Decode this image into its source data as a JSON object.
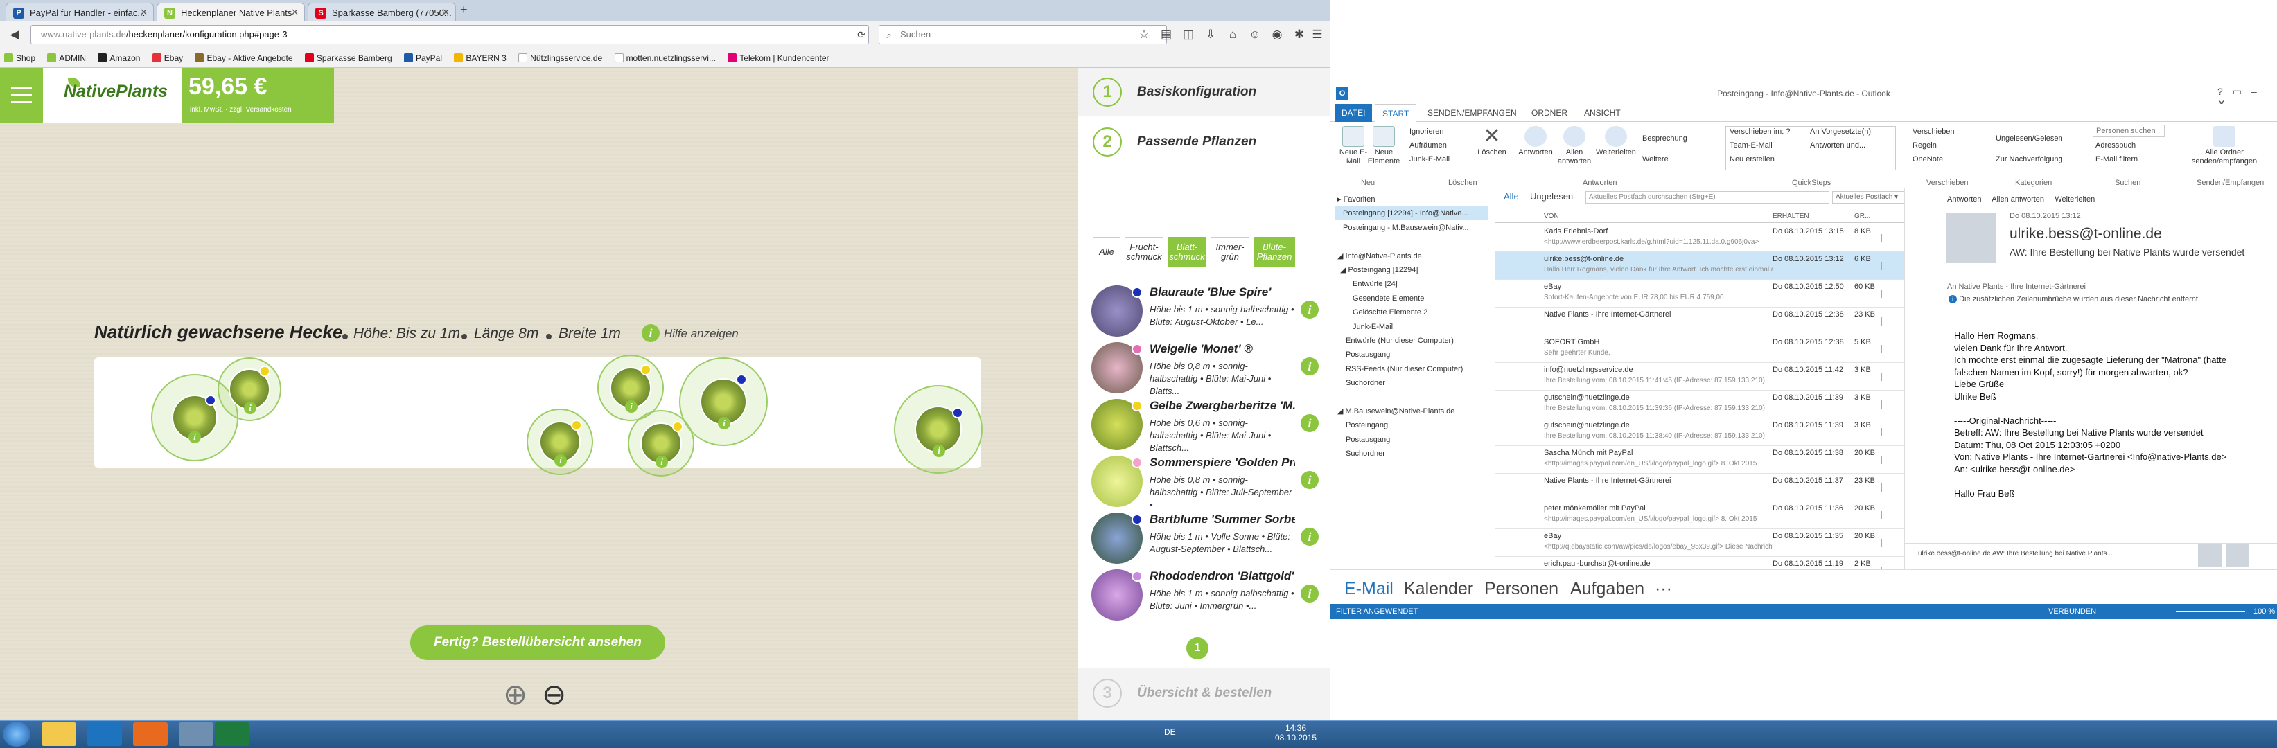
{
  "browser": {
    "tabs": [
      {
        "label": "PayPal für Händler - einfac...",
        "active": false
      },
      {
        "label": "Heckenplaner Native Plants",
        "active": true
      },
      {
        "label": "Sparkasse Bamberg (77050...",
        "active": false
      }
    ],
    "new_tab": "+",
    "url_prefix": "www.native-plants.de",
    "url_path": "/heckenplaner/konfiguration.php#page-3",
    "search_placeholder": "Suchen",
    "bookmarks": [
      "Shop",
      "ADMIN",
      "Amazon",
      "Ebay",
      "Ebay - Aktive Angebote",
      "Sparkasse Bamberg",
      "PayPal",
      "BAYERN 3",
      "Nützlingsservice.de",
      "motten.nuetzlingsservi...",
      "Telekom | Kundencenter"
    ]
  },
  "site": {
    "logo_text": "NativePlants",
    "price": "59,65 €",
    "price_note": "inkl. MwSt. · zzgl. Versandkosten",
    "hedge_title": "Natürlich gewachsene Hecke",
    "hedge_height": "Höhe: Bis zu 1m",
    "hedge_length": "Länge 8m",
    "hedge_width": "Breite 1m",
    "help_label": "Hilfe anzeigen",
    "done_button": "Fertig? Bestellübersicht ansehen",
    "zoom_in": "⊕",
    "zoom_out": "⊖",
    "info_glyph": "i"
  },
  "panel": {
    "step1": {
      "num": "1",
      "label": "Basiskonfiguration"
    },
    "step2": {
      "num": "2",
      "label": "Passende Pflanzen"
    },
    "step3": {
      "num": "3",
      "label": "Übersicht & bestellen"
    },
    "filters": [
      {
        "label": "Alle",
        "active": false
      },
      {
        "label": "Frucht-\nschmuck",
        "active": false
      },
      {
        "label": "Blatt-\nschmuck",
        "active": true
      },
      {
        "label": "Immer-\ngrün",
        "active": false
      },
      {
        "label": "Blüte-\nPflanzen",
        "active": true
      }
    ],
    "plants": [
      {
        "name": "Blauraute 'Blue Spire'",
        "desc": "Höhe bis 1 m • sonnig-halbschattig • Blüte: August-Oktober • Le...",
        "dot": "#1a2fb8"
      },
      {
        "name": "Weigelie 'Monet' ®",
        "desc": "Höhe bis 0,8 m • sonnig-halbschattig • Blüte: Mai-Juni • Blatts...",
        "dot": "#e36fb7"
      },
      {
        "name": "Gelbe Zwergberberitze 'M...",
        "desc": "Höhe bis 0,6 m • sonnig-halbschattig • Blüte: Mai-Juni • Blattsch...",
        "dot": "#f2d31b"
      },
      {
        "name": "Sommerspiere 'Golden Pri...",
        "desc": "Höhe bis 0,8 m • sonnig-halbschattig • Blüte: Juli-September •",
        "dot": "#f4a3cf"
      },
      {
        "name": "Bartblume 'Summer Sorbe...",
        "desc": "Höhe bis 1 m • Volle Sonne • Blüte: August-September • Blattsch...",
        "dot": "#1a2fb8"
      },
      {
        "name": "Rhododendron 'Blattgold'",
        "desc": "Höhe bis 1 m • sonnig-halbschattig • Blüte: Juni • Immergrün •...",
        "dot": "#c78be0"
      }
    ],
    "page": "1"
  },
  "outlook": {
    "title": "Posteingang - Info@Native-Plants.de - Outlook",
    "menu": [
      "DATEI",
      "START",
      "SENDEN/EMPFANGEN",
      "ORDNER",
      "ANSICHT"
    ],
    "ribbon": {
      "new_email": "Neue E-Mail",
      "new_items": "Neue Elemente",
      "group_new": "Neu",
      "ignore": "Ignorieren",
      "cleanup": "Aufräumen",
      "junk": "Junk-E-Mail",
      "delete": "Löschen",
      "group_delete": "Löschen",
      "reply": "Antworten",
      "reply_all": "Allen antworten",
      "forward": "Weiterleiten",
      "meeting": "Besprechung",
      "more": "Weitere",
      "group_reply": "Antworten",
      "qs1": "Verschieben im: ?",
      "qs2": "Team-E-Mail",
      "qs3": "Neu erstellen",
      "qs4": "An Vorgesetzte(n)",
      "qs5": "Antworten und...",
      "group_quick": "QuickSteps",
      "move": "Verschieben",
      "rules": "Regeln",
      "onenote": "OneNote",
      "group_move": "Verschieben",
      "unread": "Ungelesen/Gelesen",
      "followup": "Zur Nachverfolgung",
      "group_tags": "Kategorien",
      "search_people": "Personen suchen",
      "addressbook": "Adressbuch",
      "filter": "E-Mail filtern",
      "group_find": "Suchen",
      "sendall": "Alle Ordner senden/empfangen",
      "group_send": "Senden/Empfangen"
    },
    "folders": [
      {
        "label": "▸ Favoriten",
        "indent": 0,
        "sel": false
      },
      {
        "label": "Posteingang [12294]  - Info@Native...",
        "indent": 8,
        "sel": true
      },
      {
        "label": "Posteingang  - M.Bausewein@Nativ...",
        "indent": 8,
        "sel": false
      },
      {
        "label": "",
        "indent": 0,
        "sel": false
      },
      {
        "label": "◢ Info@Native-Plants.de",
        "indent": 0,
        "sel": false
      },
      {
        "label": "◢ Posteingang [12294]",
        "indent": 4,
        "sel": false
      },
      {
        "label": "Entwürfe [24]",
        "indent": 22,
        "sel": false
      },
      {
        "label": "Gesendete Elemente",
        "indent": 22,
        "sel": false
      },
      {
        "label": "Gelöschte Elemente  2",
        "indent": 22,
        "sel": false
      },
      {
        "label": "Junk-E-Mail",
        "indent": 22,
        "sel": false
      },
      {
        "label": "Entwürfe (Nur dieser Computer)",
        "indent": 12,
        "sel": false
      },
      {
        "label": "Postausgang",
        "indent": 12,
        "sel": false
      },
      {
        "label": "RSS-Feeds (Nur dieser Computer)",
        "indent": 12,
        "sel": false
      },
      {
        "label": "Suchordner",
        "indent": 12,
        "sel": false
      },
      {
        "label": "",
        "indent": 0,
        "sel": false
      },
      {
        "label": "◢ M.Bausewein@Native-Plants.de",
        "indent": 0,
        "sel": false
      },
      {
        "label": "Posteingang",
        "indent": 12,
        "sel": false
      },
      {
        "label": "Postausgang",
        "indent": 12,
        "sel": false
      },
      {
        "label": "Suchordner",
        "indent": 12,
        "sel": false
      }
    ],
    "list_tabs": {
      "all": "Alle",
      "unread": "Ungelesen",
      "search": "Aktuelles Postfach durchsuchen (Strg+E)",
      "scope": "Aktuelles Postfach ▾"
    },
    "columns": {
      "from": "VON",
      "received": "ERHALTEN",
      "size": "GR..."
    },
    "mails": [
      {
        "from": "Karls Erlebnis-Dorf",
        "preview": "<http://www.erdbeerpost.karls.de/g.html?uid=1.125.11.da.0.g906j0va> ",
        "date": "Do 08.10.2015 13:15",
        "size": "8 KB",
        "sel": false
      },
      {
        "from": "ulrike.bess@t-online.de",
        "preview": "Hallo Herr Rogmans,  vielen Dank für Ihre Antwort.  Ich möchte erst einmal die",
        "date": "Do 08.10.2015 13:12",
        "size": "6 KB",
        "sel": true
      },
      {
        "from": "eBay",
        "preview": "Sofort-Kaufen-Angebote von EUR 78,00 bis EUR 4.759,00.",
        "date": "Do 08.10.2015 12:50",
        "size": "60 KB",
        "sel": false
      },
      {
        "from": "Native Plants - Ihre Internet-Gärtnerei",
        "preview": "",
        "date": "Do 08.10.2015 12:38",
        "size": "23 KB",
        "sel": false
      },
      {
        "from": "SOFORT GmbH",
        "preview": "Sehr geehrter Kunde,",
        "date": "Do 08.10.2015 12:38",
        "size": "5 KB",
        "sel": false
      },
      {
        "from": "info@nuetzlingsservice.de",
        "preview": "Ihre Bestellung vom: 08.10.2015 11:41:45 (IP-Adresse: 87.159.133.210)",
        "date": "Do 08.10.2015 11:42",
        "size": "3 KB",
        "sel": false
      },
      {
        "from": "gutschein@nuetzlinge.de",
        "preview": "Ihre Bestellung vom: 08.10.2015 11:39:36 (IP-Adresse: 87.159.133.210)",
        "date": "Do 08.10.2015 11:39",
        "size": "3 KB",
        "sel": false
      },
      {
        "from": "gutschein@nuetzlinge.de",
        "preview": "Ihre Bestellung vom: 08.10.2015 11:38:40 (IP-Adresse: 87.159.133.210)",
        "date": "Do 08.10.2015 11:39",
        "size": "3 KB",
        "sel": false
      },
      {
        "from": "Sascha Münch mit PayPal",
        "preview": "<http://images.paypal.com/en_US/i/logo/paypal_logo.gif>      8. Okt 2015",
        "date": "Do 08.10.2015 11:38",
        "size": "20 KB",
        "sel": false
      },
      {
        "from": "Native Plants - Ihre Internet-Gärtnerei",
        "preview": "",
        "date": "Do 08.10.2015 11:37",
        "size": "23 KB",
        "sel": false
      },
      {
        "from": "peter mönkemöller mit PayPal",
        "preview": "<http://images.paypal.com/en_US/i/logo/paypal_logo.gif>      8. Okt 2015",
        "date": "Do 08.10.2015 11:36",
        "size": "20 KB",
        "sel": false
      },
      {
        "from": "eBay",
        "preview": "<http://q.ebaystatic.com/aw/pics/de/logos/ebay_95x39.gif>     Diese Nachricht",
        "date": "Do 08.10.2015 11:35",
        "size": "20 KB",
        "sel": false
      },
      {
        "from": "erich.paul-burchstr@t-online.de",
        "preview": "",
        "date": "Do 08.10.2015 11:19",
        "size": "2 KB",
        "sel": false
      }
    ],
    "reading": {
      "actions": [
        "Antworten",
        "Allen antworten",
        "Weiterleiten"
      ],
      "date": "Do 08.10.2015 13:12",
      "sender": "ulrike.bess@t-online.de",
      "subject": "AW: Ihre Bestellung bei Native Plants wurde versendet",
      "to": "An    Native Plants - Ihre Internet-Gärtnerei",
      "notice": "Die zusätzlichen Zeilenumbrüche wurden aus dieser Nachricht entfernt.",
      "body": [
        "Hallo Herr Rogmans,",
        "vielen Dank für Ihre Antwort.",
        "Ich möchte erst einmal die zugesagte Lieferung der \"Matrona\" (hatte",
        "falschen Namen im Kopf, sorry!) für morgen  abwarten, ok?",
        "Liebe Grüße",
        "Ulrike Beß",
        "",
        "-----Original-Nachricht-----",
        "Betreff: AW: Ihre Bestellung bei Native Plants wurde versendet",
        "Datum: Thu, 08 Oct 2015 12:03:05 +0200",
        "Von: Native Plants - Ihre Internet-Gärtnerei <Info@native-Plants.de>",
        "An: <ulrike.bess@t-online.de>",
        "",
        "Hallo Frau Beß"
      ],
      "people": "ulrike.bess@t-online.de  AW: Ihre Bestellung bei Native Plants..."
    },
    "nav": [
      "E-Mail",
      "Kalender",
      "Personen",
      "Aufgaben",
      "···"
    ],
    "status_left": "FILTER ANGEWENDET",
    "status_right": "VERBUNDEN",
    "zoom": "100 %"
  },
  "taskbar": {
    "lang": "DE",
    "time": "14:36",
    "date": "08.10.2015"
  }
}
